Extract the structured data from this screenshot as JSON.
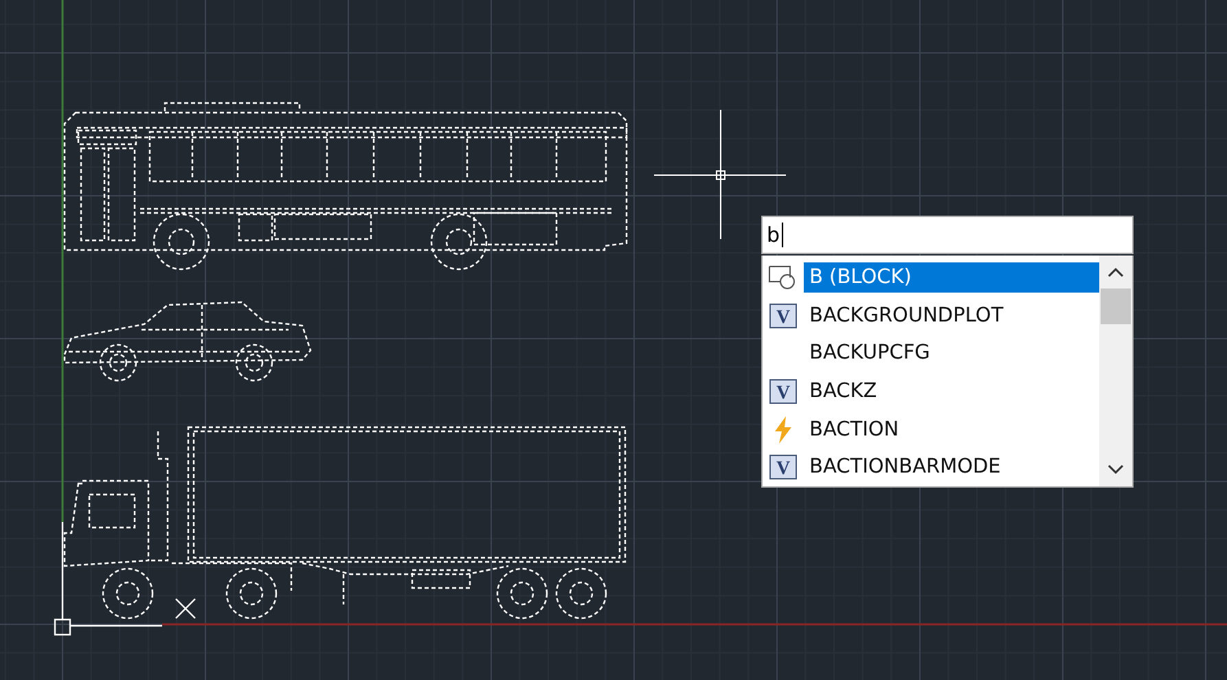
{
  "command_input": {
    "value": "b"
  },
  "suggestions": [
    {
      "label": "B (BLOCK)",
      "kind": "block",
      "selected": true
    },
    {
      "label": "BACKGROUNDPLOT",
      "kind": "variable",
      "icon_text": "V",
      "selected": false
    },
    {
      "label": "BACKUPCFG",
      "kind": "none",
      "selected": false
    },
    {
      "label": "BACKZ",
      "kind": "variable",
      "icon_text": "V",
      "selected": false
    },
    {
      "label": "BACTION",
      "kind": "action",
      "selected": false
    },
    {
      "label": "BACTIONBARMODE",
      "kind": "variable",
      "icon_text": "V",
      "selected": false
    }
  ]
}
